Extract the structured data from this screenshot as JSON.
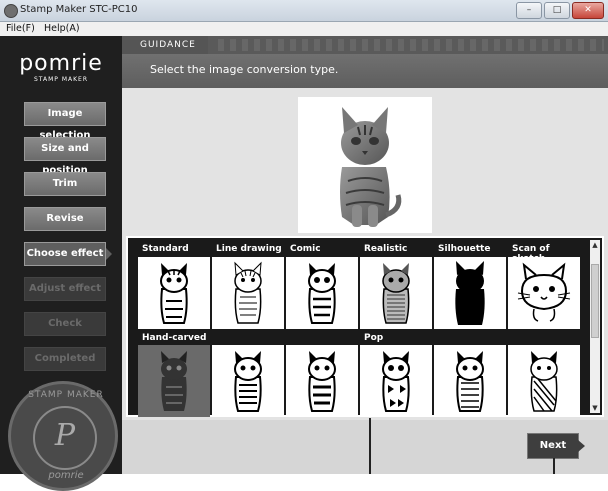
{
  "window": {
    "title": "Stamp Maker STC-PC10"
  },
  "menu": {
    "file": "File(F)",
    "help": "Help(A)"
  },
  "logo": {
    "main": "pomrie",
    "sub": "STAMP MAKER"
  },
  "sidebar": {
    "items": [
      {
        "label": "Image selection",
        "state": "normal"
      },
      {
        "label": "Size and position",
        "state": "normal"
      },
      {
        "label": "Trim",
        "state": "normal"
      },
      {
        "label": "Revise",
        "state": "normal"
      },
      {
        "label": "Choose effect",
        "state": "active"
      },
      {
        "label": "Adjust effect",
        "state": "disabled"
      },
      {
        "label": "Check",
        "state": "disabled"
      },
      {
        "label": "Completed",
        "state": "disabled"
      }
    ]
  },
  "stamp_badge": {
    "top": "STAMP MAKER",
    "letter": "P",
    "bottom": "pomrie"
  },
  "guidance": {
    "tab": "GUIDANCE",
    "text": "Select the image conversion type."
  },
  "effects": {
    "row1_labels": [
      "Standard",
      "Line drawing",
      "Comic",
      "Realistic",
      "Silhouette",
      "Scan of sketch"
    ],
    "row2_labels": [
      "Hand-carved",
      "",
      "",
      "Pop",
      "",
      ""
    ],
    "selected": "Hand-carved"
  },
  "buttons": {
    "next": "Next"
  },
  "colors": {
    "sidebar_bg": "#1f1f1f",
    "button_gray": "#7a7a7a",
    "active": "#5f5f5f",
    "disabled": "#3a3a3a"
  }
}
